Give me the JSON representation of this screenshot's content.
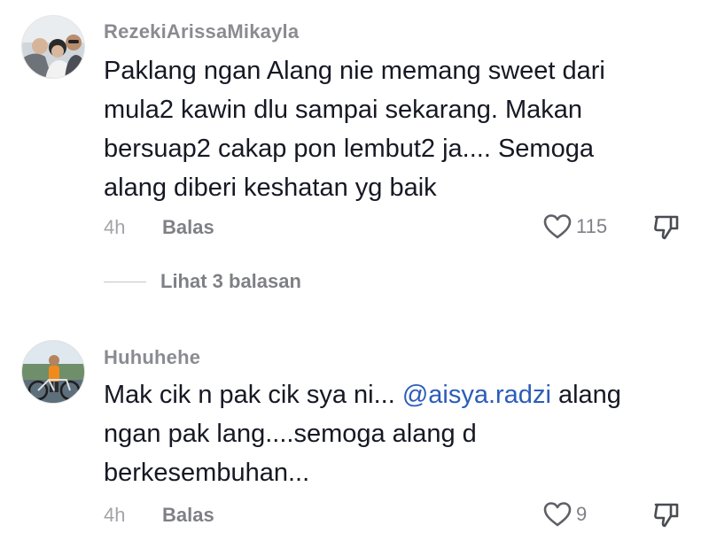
{
  "comments": [
    {
      "username": "RezekiArissaMikayla",
      "text_lines": [
        "Paklang ngan Alang nie memang sweet dari",
        "mula2 kawin dlu sampai sekarang. Makan",
        "bersuap2 cakap pon lembut2 ja.... Semoga",
        "alang diberi keshatan yg baik"
      ],
      "time": "4h",
      "reply_label": "Balas",
      "like_count": "115",
      "view_replies_label": "Lihat 3 balasan"
    },
    {
      "username": "Huhuhehe",
      "text_before_mention": "Mak cik n pak cik sya ni... ",
      "mention": "@aisya.radzi",
      "text_after_mention": " alang",
      "text_lines": [
        "ngan pak lang....semoga alang d",
        "berkesembuhan..."
      ],
      "time": "4h",
      "reply_label": "Balas",
      "like_count": "9"
    }
  ],
  "icons": {
    "like": "heart-outline-icon",
    "dislike": "thumbs-down-outline-icon"
  },
  "colors": {
    "text": "#161823",
    "mention": "#2b5db9"
  }
}
